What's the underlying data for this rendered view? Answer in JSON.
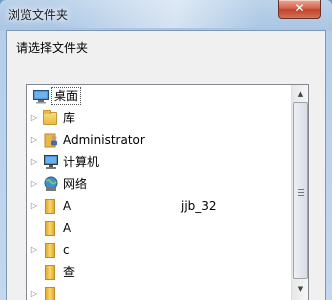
{
  "window": {
    "title": "浏览文件夹",
    "close_glyph": "✕"
  },
  "prompt": "请选择文件夹",
  "tree": {
    "items": [
      {
        "label": "桌面",
        "icon": "desktop-icon",
        "selected": true,
        "expandable": false
      },
      {
        "label": "库",
        "icon": "library-icon",
        "selected": false,
        "expandable": true
      },
      {
        "label": "Administrator",
        "icon": "user-folder-icon",
        "selected": false,
        "expandable": true
      },
      {
        "label": "计算机",
        "icon": "computer-icon",
        "selected": false,
        "expandable": true
      },
      {
        "label": "网络",
        "icon": "network-icon",
        "selected": false,
        "expandable": true
      },
      {
        "label": "A",
        "suffix": "jjb_32",
        "icon": "folder-icon",
        "selected": false,
        "expandable": true
      },
      {
        "label": "A",
        "icon": "folder-icon",
        "selected": false,
        "expandable": false
      },
      {
        "label": "c",
        "icon": "folder-icon",
        "selected": false,
        "expandable": true
      },
      {
        "label": "查",
        "icon": "folder-icon",
        "selected": false,
        "expandable": false
      }
    ]
  },
  "colors": {
    "close_button": "#c7482f",
    "frame": "#b5cde8"
  }
}
